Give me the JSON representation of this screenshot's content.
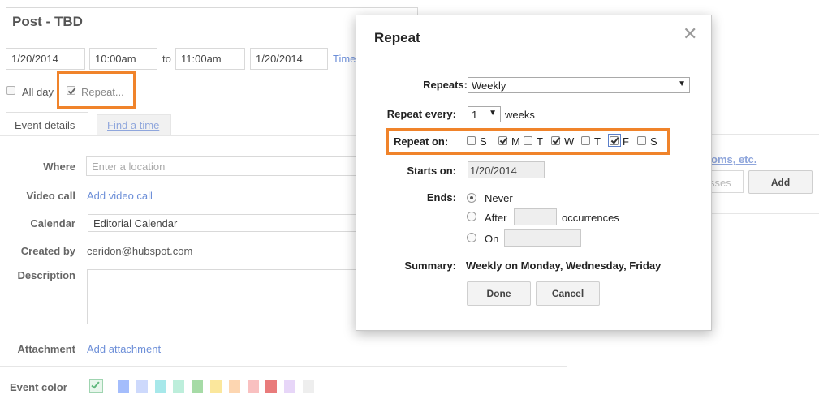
{
  "event": {
    "title": "Post - TBD",
    "start_date": "1/20/2014",
    "start_time": "10:00am",
    "to_label": "to",
    "end_time": "11:00am",
    "end_date": "1/20/2014",
    "timezone_link": "Time",
    "all_day_label": "All day",
    "repeat_label": "Repeat..."
  },
  "tabs": {
    "event_details": "Event details",
    "find_a_time": "Find a time"
  },
  "details": {
    "where_label": "Where",
    "where_placeholder": "Enter a location",
    "video_call_label": "Video call",
    "video_call_link": "Add video call",
    "calendar_label": "Calendar",
    "calendar_value": "Editorial Calendar",
    "created_by_label": "Created by",
    "created_by_value": "ceridon@hubspot.com",
    "description_label": "Description",
    "attachment_label": "Attachment",
    "attachment_link": "Add attachment",
    "event_color_label": "Event color",
    "event_colors": [
      "#a4bdfc",
      "#cdd9fc",
      "#a7e8ea",
      "#bdeedb",
      "#a6dba6",
      "#fbe79c",
      "#fdd6b1",
      "#f9c0c0",
      "#e97b7b",
      "#e7d6f8",
      "#eeeeee"
    ]
  },
  "right_panel": {
    "rooms_link_partial": "oms, etc.",
    "guest_placeholder_partial": "sses",
    "add_button": "Add"
  },
  "dialog": {
    "title": "Repeat",
    "repeats_label": "Repeats:",
    "repeats_value": "Weekly",
    "repeat_every_label": "Repeat every:",
    "repeat_every_value": "1",
    "repeat_every_unit": "weeks",
    "repeat_on_label": "Repeat on:",
    "days": [
      {
        "letter": "S",
        "checked": false
      },
      {
        "letter": "M",
        "checked": true
      },
      {
        "letter": "T",
        "checked": false
      },
      {
        "letter": "W",
        "checked": true
      },
      {
        "letter": "T",
        "checked": false
      },
      {
        "letter": "F",
        "checked": true
      },
      {
        "letter": "S",
        "checked": false
      }
    ],
    "starts_on_label": "Starts on:",
    "starts_on_value": "1/20/2014",
    "ends_label": "Ends:",
    "ends_never": "Never",
    "ends_after": "After",
    "ends_after_suffix": "occurrences",
    "ends_on": "On",
    "summary_label": "Summary:",
    "summary_value": "Weekly on Monday, Wednesday, Friday",
    "done_button": "Done",
    "cancel_button": "Cancel"
  },
  "colors": {
    "highlight": "#f0832a",
    "link": "#6d8fd8"
  }
}
